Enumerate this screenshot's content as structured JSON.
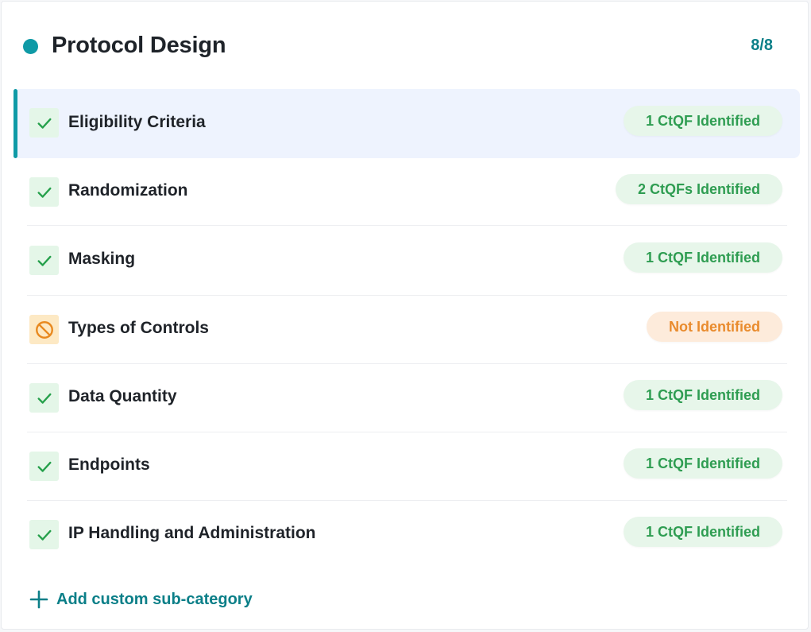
{
  "colors": {
    "accent": "#0f9aa6",
    "link": "#0b7f88",
    "ok_text": "#2f9d52",
    "warn_text": "#e98b2d"
  },
  "header": {
    "title": "Protocol Design",
    "count": "8/8",
    "dot_icon": "status-dot"
  },
  "items": [
    {
      "label": "Eligibility Criteria",
      "status": "ok",
      "status_icon": "check-icon",
      "badge": "1 CtQF Identified",
      "selected": true
    },
    {
      "label": "Randomization",
      "status": "ok",
      "status_icon": "check-icon",
      "badge": "2 CtQFs Identified",
      "selected": false
    },
    {
      "label": "Masking",
      "status": "ok",
      "status_icon": "check-icon",
      "badge": "1 CtQF Identified",
      "selected": false
    },
    {
      "label": "Types of Controls",
      "status": "warn",
      "status_icon": "prohibited-icon",
      "badge": "Not Identified",
      "selected": false
    },
    {
      "label": "Data Quantity",
      "status": "ok",
      "status_icon": "check-icon",
      "badge": "1 CtQF Identified",
      "selected": false
    },
    {
      "label": "Endpoints",
      "status": "ok",
      "status_icon": "check-icon",
      "badge": "1 CtQF Identified",
      "selected": false
    },
    {
      "label": "IP Handling and Administration",
      "status": "ok",
      "status_icon": "check-icon",
      "badge": "1 CtQF Identified",
      "selected": false
    }
  ],
  "footer": {
    "add_label": "Add custom sub-category",
    "add_icon": "plus-icon"
  }
}
